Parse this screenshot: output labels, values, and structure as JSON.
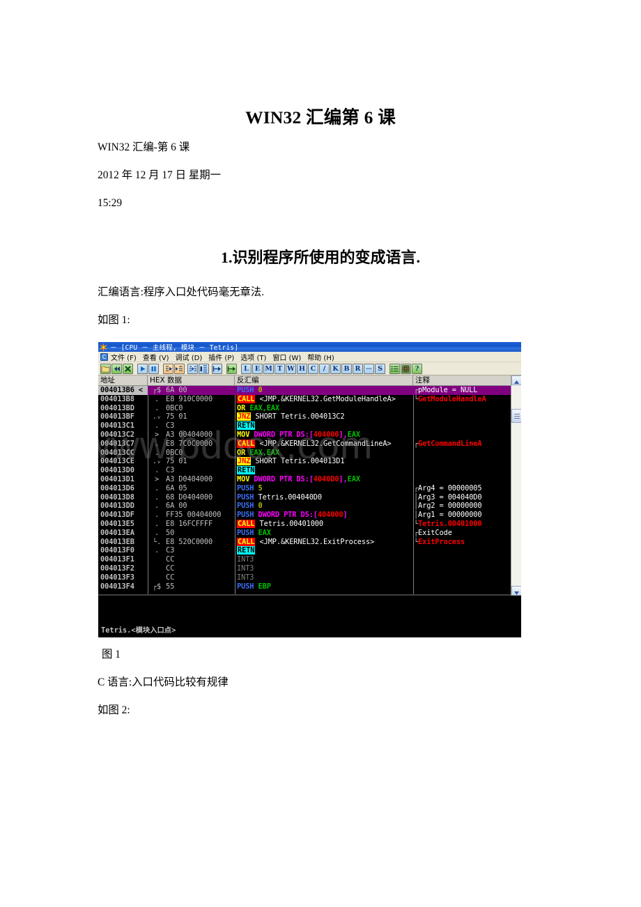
{
  "document": {
    "title": "WIN32 汇编第 6 课",
    "subtitle": "WIN32 汇编-第 6 课",
    "date": "2012 年 12 月 17 日 星期一",
    "time": "15:29",
    "section_heading": "1.识别程序所使用的变成语言.",
    "asm_line": "汇编语言:程序入口处代码毫无章法.",
    "fig1_ref": "如图 1:",
    "fig1_caption": "图 1",
    "c_line": "C 语言:入口代码比较有规律",
    "fig2_ref": "如图 2:"
  },
  "watermark": "www.bdocx.com",
  "olly": {
    "title": "－ [CPU － 主线程, 模块 － Tetris]",
    "logo_icon": "ollydbg-logo-icon",
    "menu": {
      "doc_icon": "C",
      "items": [
        {
          "name": "file",
          "label": "文件 (F)"
        },
        {
          "name": "view",
          "label": "查看 (V)"
        },
        {
          "name": "debug",
          "label": "调试 (D)"
        },
        {
          "name": "plugins",
          "label": "插件 (P)"
        },
        {
          "name": "options",
          "label": "选项 (T)"
        },
        {
          "name": "window",
          "label": "窗口 (W)"
        },
        {
          "name": "help",
          "label": "帮助 (H)"
        }
      ]
    },
    "toolbar": {
      "groups": [
        {
          "name": "open",
          "style": "green",
          "icon": "open-folder-icon",
          "label": ""
        },
        {
          "name": "restart",
          "style": "green",
          "icon": "rewind-icon",
          "label": ""
        },
        {
          "name": "close",
          "style": "green",
          "icon": "close-x-icon",
          "label": ""
        },
        {
          "name": "gap1",
          "style": "gap",
          "icon": "",
          "label": ""
        },
        {
          "name": "run",
          "style": "blue",
          "icon": "play-icon",
          "label": ""
        },
        {
          "name": "pause",
          "style": "blue",
          "icon": "pause-icon",
          "label": ""
        },
        {
          "name": "gap2",
          "style": "gap",
          "icon": "",
          "label": ""
        },
        {
          "name": "step-into",
          "style": "orange",
          "icon": "step-into-icon",
          "label": ""
        },
        {
          "name": "step-over",
          "style": "orange",
          "icon": "step-over-icon",
          "label": ""
        },
        {
          "name": "gap3",
          "style": "gap-s",
          "icon": "",
          "label": ""
        },
        {
          "name": "trace-into",
          "style": "blue",
          "icon": "trace-into-icon",
          "label": ""
        },
        {
          "name": "trace-over",
          "style": "blue",
          "icon": "trace-over-icon",
          "label": ""
        },
        {
          "name": "gap4",
          "style": "gap-s",
          "icon": "",
          "label": ""
        },
        {
          "name": "execute-till-return",
          "style": "blue",
          "icon": "exec-return-icon",
          "label": ""
        },
        {
          "name": "gap5",
          "style": "gap",
          "icon": "",
          "label": ""
        },
        {
          "name": "run-to-selection",
          "style": "green",
          "icon": "run-to-sel-icon",
          "label": ""
        },
        {
          "name": "gap6",
          "style": "gap",
          "icon": "",
          "label": ""
        },
        {
          "name": "log",
          "style": "blue",
          "icon": "",
          "label": "L"
        },
        {
          "name": "executable-modules",
          "style": "blue",
          "icon": "",
          "label": "E"
        },
        {
          "name": "memory",
          "style": "blue",
          "icon": "",
          "label": "M"
        },
        {
          "name": "threads",
          "style": "blue",
          "icon": "",
          "label": "T"
        },
        {
          "name": "windows",
          "style": "blue",
          "icon": "",
          "label": "W"
        },
        {
          "name": "handles",
          "style": "blue",
          "icon": "",
          "label": "H"
        },
        {
          "name": "cpu",
          "style": "blue",
          "icon": "",
          "label": "C"
        },
        {
          "name": "patches",
          "style": "blue",
          "icon": "",
          "label": "/"
        },
        {
          "name": "call-stack",
          "style": "blue",
          "icon": "",
          "label": "K"
        },
        {
          "name": "breakpoints",
          "style": "blue",
          "icon": "",
          "label": "B"
        },
        {
          "name": "references",
          "style": "blue",
          "icon": "",
          "label": "R"
        },
        {
          "name": "run-trace",
          "style": "blue",
          "icon": "",
          "label": "..."
        },
        {
          "name": "source",
          "style": "blue",
          "icon": "",
          "label": "S"
        },
        {
          "name": "gap7",
          "style": "gap",
          "icon": "",
          "label": ""
        },
        {
          "name": "options-list",
          "style": "green",
          "icon": "options-list-icon",
          "label": ""
        },
        {
          "name": "appearance",
          "style": "green",
          "icon": "appearance-icon",
          "label": ""
        },
        {
          "name": "help-btn",
          "style": "green",
          "icon": "",
          "label": "?"
        }
      ]
    },
    "columns": [
      {
        "name": "address",
        "label": "地址"
      },
      {
        "name": "hex-dump",
        "label": "HEX 数据"
      },
      {
        "name": "disassembly",
        "label": "反汇编"
      },
      {
        "name": "comment",
        "label": "注释"
      }
    ],
    "rows": [
      {
        "addr": "004013B6",
        "addr_suffix": "<",
        "mark": "┌$",
        "hex": "6A 00",
        "dis": [
          {
            "t": "PUSH",
            "c": "push"
          },
          {
            "t": " ",
            "c": "plain"
          },
          {
            "t": "0",
            "c": "olive"
          }
        ],
        "com": "pModule = NULL",
        "com_brk": "┌",
        "com_color": "white",
        "selected": true
      },
      {
        "addr": "004013B8",
        "addr_suffix": "",
        "mark": ".",
        "hex": "E8 910C0000",
        "dis": [
          {
            "t": "CALL",
            "c": "call"
          },
          {
            "t": " <JMP.&KERNEL32.GetModuleHandleA>",
            "c": "white"
          }
        ],
        "com": "GetModuleHandleA",
        "com_brk": "└",
        "com_color": "red",
        "selected": false
      },
      {
        "addr": "004013BD",
        "addr_suffix": "",
        "mark": ".",
        "hex": "0BC0",
        "dis": [
          {
            "t": "OR",
            "c": "or"
          },
          {
            "t": " ",
            "c": "plain"
          },
          {
            "t": "EAX,EAX",
            "c": "green"
          }
        ],
        "com": "",
        "com_brk": "",
        "com_color": "red",
        "selected": false
      },
      {
        "addr": "004013BF",
        "addr_suffix": "",
        "mark": ".ᵥ",
        "hex": "75 01",
        "dis": [
          {
            "t": "JNZ",
            "c": "jnz"
          },
          {
            "t": " SHORT Tetris.004013C2",
            "c": "white"
          }
        ],
        "com": "",
        "com_brk": "",
        "com_color": "red",
        "selected": false
      },
      {
        "addr": "004013C1",
        "addr_suffix": "",
        "mark": ".",
        "hex": "C3",
        "dis": [
          {
            "t": "RETN",
            "c": "retn"
          }
        ],
        "com": "",
        "com_brk": "",
        "com_color": "red",
        "selected": false
      },
      {
        "addr": "004013C2",
        "addr_suffix": "",
        "mark": ">",
        "hex": "A3 00404000",
        "dis": [
          {
            "t": "MOV",
            "c": "mov"
          },
          {
            "t": " ",
            "c": "plain"
          },
          {
            "t": "DWORD PTR DS:[",
            "c": "magenta"
          },
          {
            "t": "404000",
            "c": "red"
          },
          {
            "t": "],",
            "c": "magenta"
          },
          {
            "t": "EAX",
            "c": "green"
          }
        ],
        "com": "",
        "com_brk": "",
        "com_color": "red",
        "selected": false
      },
      {
        "addr": "004013C7",
        "addr_suffix": "",
        "mark": ".",
        "hex": "E8 7C0C0000",
        "dis": [
          {
            "t": "CALL",
            "c": "call"
          },
          {
            "t": " <JMP.&KERNEL32.GetCommandLineA>",
            "c": "white"
          }
        ],
        "com": "GetCommandLineA",
        "com_brk": "┌",
        "com_color": "red",
        "selected": false
      },
      {
        "addr": "004013CC",
        "addr_suffix": "",
        "mark": ".",
        "hex": "0BC0",
        "dis": [
          {
            "t": "OR",
            "c": "or"
          },
          {
            "t": " ",
            "c": "plain"
          },
          {
            "t": "EAX,EAX",
            "c": "green"
          }
        ],
        "com": "",
        "com_brk": "",
        "com_color": "red",
        "selected": false
      },
      {
        "addr": "004013CE",
        "addr_suffix": "",
        "mark": ".ᵥ",
        "hex": "75 01",
        "dis": [
          {
            "t": "JNZ",
            "c": "jnz"
          },
          {
            "t": " SHORT Tetris.004013D1",
            "c": "white"
          }
        ],
        "com": "",
        "com_brk": "",
        "com_color": "red",
        "selected": false
      },
      {
        "addr": "004013D0",
        "addr_suffix": "",
        "mark": ".",
        "hex": "C3",
        "dis": [
          {
            "t": "RETN",
            "c": "retn"
          }
        ],
        "com": "",
        "com_brk": "",
        "com_color": "red",
        "selected": false
      },
      {
        "addr": "004013D1",
        "addr_suffix": "",
        "mark": ">",
        "hex": "A3 D0404000",
        "dis": [
          {
            "t": "MOV",
            "c": "mov"
          },
          {
            "t": " ",
            "c": "plain"
          },
          {
            "t": "DWORD PTR DS:[",
            "c": "magenta"
          },
          {
            "t": "4040D0",
            "c": "red"
          },
          {
            "t": "],",
            "c": "magenta"
          },
          {
            "t": "EAX",
            "c": "green"
          }
        ],
        "com": "",
        "com_brk": "",
        "com_color": "red",
        "selected": false
      },
      {
        "addr": "004013D6",
        "addr_suffix": "",
        "mark": ".",
        "hex": "6A 05",
        "dis": [
          {
            "t": "PUSH",
            "c": "push"
          },
          {
            "t": " ",
            "c": "plain"
          },
          {
            "t": "5",
            "c": "olive"
          }
        ],
        "com": "Arg4 = 00000005",
        "com_brk": "┌",
        "com_color": "white",
        "selected": false
      },
      {
        "addr": "004013D8",
        "addr_suffix": "",
        "mark": ".",
        "hex": "68 D0404000",
        "dis": [
          {
            "t": "PUSH",
            "c": "push"
          },
          {
            "t": " Tetris.004040D0",
            "c": "white"
          }
        ],
        "com": "Arg3 = 004040D0",
        "com_brk": "│",
        "com_color": "white",
        "selected": false
      },
      {
        "addr": "004013DD",
        "addr_suffix": "",
        "mark": ".",
        "hex": "6A 00",
        "dis": [
          {
            "t": "PUSH",
            "c": "push"
          },
          {
            "t": " ",
            "c": "plain"
          },
          {
            "t": "0",
            "c": "olive"
          }
        ],
        "com": "Arg2 = 00000000",
        "com_brk": "│",
        "com_color": "white",
        "selected": false
      },
      {
        "addr": "004013DF",
        "addr_suffix": "",
        "mark": ".",
        "hex": "FF35 00404000",
        "dis": [
          {
            "t": "PUSH",
            "c": "push"
          },
          {
            "t": " ",
            "c": "plain"
          },
          {
            "t": "DWORD PTR DS:[",
            "c": "magenta"
          },
          {
            "t": "404000",
            "c": "red"
          },
          {
            "t": "]",
            "c": "magenta"
          }
        ],
        "com": "Arg1 = 00000000",
        "com_brk": "│",
        "com_color": "white",
        "selected": false
      },
      {
        "addr": "004013E5",
        "addr_suffix": "",
        "mark": ".",
        "hex": "E8 16FCFFFF",
        "dis": [
          {
            "t": "CALL",
            "c": "call"
          },
          {
            "t": " Tetris.00401000",
            "c": "white"
          }
        ],
        "com": "Tetris.00401000",
        "com_brk": "└",
        "com_color": "red",
        "selected": false
      },
      {
        "addr": "004013EA",
        "addr_suffix": "",
        "mark": ".",
        "hex": "50",
        "dis": [
          {
            "t": "PUSH",
            "c": "push"
          },
          {
            "t": " ",
            "c": "plain"
          },
          {
            "t": "EAX",
            "c": "green"
          }
        ],
        "com": "ExitCode",
        "com_brk": "┌",
        "com_color": "white",
        "selected": false
      },
      {
        "addr": "004013EB",
        "addr_suffix": "",
        "mark": "└.",
        "hex": "E8 520C0000",
        "dis": [
          {
            "t": "CALL",
            "c": "call"
          },
          {
            "t": " <JMP.&KERNEL32.ExitProcess>",
            "c": "white"
          }
        ],
        "com": "ExitProcess",
        "com_brk": "└",
        "com_color": "red",
        "selected": false
      },
      {
        "addr": "004013F0",
        "addr_suffix": "",
        "mark": ".",
        "hex": "C3",
        "dis": [
          {
            "t": "RETN",
            "c": "retn"
          }
        ],
        "com": "",
        "com_brk": "",
        "com_color": "red",
        "selected": false
      },
      {
        "addr": "004013F1",
        "addr_suffix": "",
        "mark": "",
        "hex": "CC",
        "dis": [
          {
            "t": "INT3",
            "c": "int3"
          }
        ],
        "com": "",
        "com_brk": "",
        "com_color": "red",
        "selected": false
      },
      {
        "addr": "004013F2",
        "addr_suffix": "",
        "mark": "",
        "hex": "CC",
        "dis": [
          {
            "t": "INT3",
            "c": "int3"
          }
        ],
        "com": "",
        "com_brk": "",
        "com_color": "red",
        "selected": false
      },
      {
        "addr": "004013F3",
        "addr_suffix": "",
        "mark": "",
        "hex": "CC",
        "dis": [
          {
            "t": "INT3",
            "c": "int3"
          }
        ],
        "com": "",
        "com_brk": "",
        "com_color": "red",
        "selected": false
      },
      {
        "addr": "004013F4",
        "addr_suffix": "",
        "mark": "┌$",
        "hex": "55",
        "dis": [
          {
            "t": "PUSH",
            "c": "push"
          },
          {
            "t": " ",
            "c": "plain"
          },
          {
            "t": "EBP",
            "c": "green"
          }
        ],
        "com": "",
        "com_brk": "",
        "com_color": "red",
        "selected": false
      }
    ],
    "status_text": "Tetris.<模块入口点>",
    "scrollbar": {
      "up_arrow": "scroll-up-icon",
      "down_arrow": "scroll-down-icon",
      "thumb": "scroll-thumb"
    },
    "colors": {
      "selection": "#800080",
      "call": "#ff0000",
      "jump": "#ffff00",
      "comment": "#ff0000",
      "titlebar": "#1456c9"
    }
  }
}
